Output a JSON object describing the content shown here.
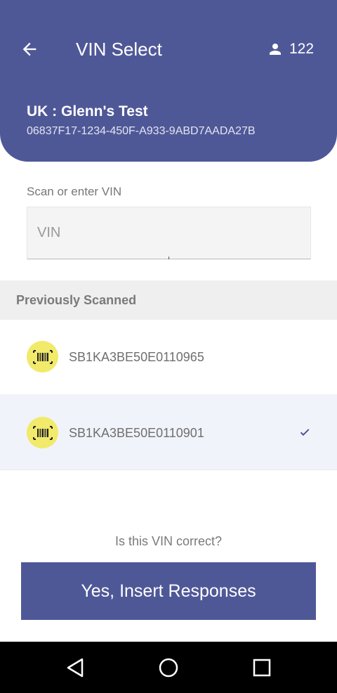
{
  "header": {
    "title": "VIN Select",
    "user_count": "122",
    "org_name": "UK : Glenn's Test",
    "org_id": "06837F17-1234-450F-A933-9ABD7AADA27B"
  },
  "vin_field": {
    "label": "Scan or enter VIN",
    "placeholder": "VIN",
    "value": ""
  },
  "previously_scanned": {
    "title": "Previously Scanned",
    "items": [
      {
        "vin": "SB1KA3BE50E0110965",
        "selected": false
      },
      {
        "vin": "SB1KA3BE50E0110901",
        "selected": true
      }
    ]
  },
  "confirm": {
    "question": "Is this VIN correct?",
    "button_label": "Yes, Insert Responses"
  },
  "colors": {
    "primary": "#4f5897",
    "barcode_badge": "#f1ea6a",
    "selected_row": "#f1f3fa"
  },
  "icons": [
    "arrow-left-icon",
    "person-icon",
    "barcode-icon",
    "check-icon",
    "nav-back-icon",
    "nav-home-icon",
    "nav-recents-icon"
  ]
}
